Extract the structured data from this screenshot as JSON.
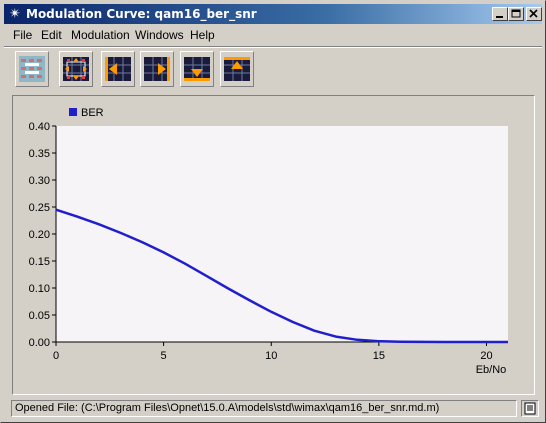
{
  "window": {
    "title": "Modulation Curve: qam16_ber_snr"
  },
  "menu": [
    "File",
    "Edit",
    "Modulation",
    "Windows",
    "Help"
  ],
  "toolbar": {
    "buttons": [
      "grid-toggle-icon",
      "fit-view-icon",
      "pan-left-icon",
      "pan-right-icon",
      "pan-down-icon",
      "pan-up-icon"
    ]
  },
  "status": {
    "text": "Opened File: (C:\\Program Files\\Opnet\\15.0.A\\models\\std\\wimax\\qam16_ber_snr.md.m)"
  },
  "colors": {
    "series": "#1f1fcc",
    "plot_bg": "#f7f4f8",
    "title_bar": "#0a246a"
  },
  "chart_data": {
    "type": "line",
    "xlabel": "Eb/No",
    "ylabel": "",
    "xlim": [
      0,
      21
    ],
    "ylim": [
      0,
      0.4
    ],
    "x_ticks": [
      "0",
      "5",
      "10",
      "15",
      "20"
    ],
    "y_ticks": [
      "0.00",
      "0.05",
      "0.10",
      "0.15",
      "0.20",
      "0.25",
      "0.30",
      "0.35",
      "0.40"
    ],
    "legend": "top-left",
    "grid": false,
    "series": [
      {
        "name": "BER",
        "x": [
          0,
          1,
          2,
          3,
          4,
          5,
          6,
          7,
          8,
          9,
          10,
          11,
          12,
          13,
          14,
          15,
          16,
          17,
          18,
          19,
          20,
          21
        ],
        "values": [
          0.245,
          0.232,
          0.218,
          0.202,
          0.185,
          0.166,
          0.145,
          0.122,
          0.099,
          0.077,
          0.056,
          0.037,
          0.021,
          0.01,
          0.004,
          0.0015,
          0.0005,
          0.0001,
          0,
          0,
          0,
          0
        ]
      }
    ]
  }
}
